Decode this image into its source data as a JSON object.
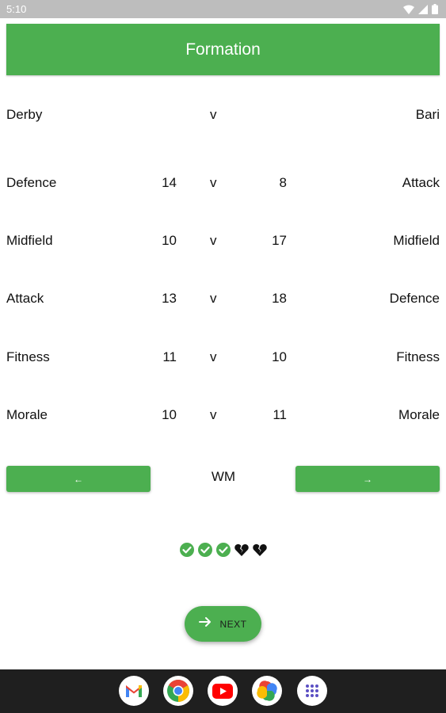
{
  "status_bar": {
    "time": "5:10"
  },
  "top_bar": {
    "title": "Formation"
  },
  "teams": {
    "home": "Derby",
    "vs": "v",
    "away": "Bari"
  },
  "stats": [
    {
      "left_label": "Defence",
      "left_value": "14",
      "vs": "v",
      "right_value": "8",
      "right_label": "Attack"
    },
    {
      "left_label": "Midfield",
      "left_value": "10",
      "vs": "v",
      "right_value": "17",
      "right_label": "Midfield"
    },
    {
      "left_label": "Attack",
      "left_value": "13",
      "vs": "v",
      "right_value": "18",
      "right_label": "Defence"
    },
    {
      "left_label": "Fitness",
      "left_value": "11",
      "vs": "v",
      "right_value": "10",
      "right_label": "Fitness"
    },
    {
      "left_label": "Morale",
      "left_value": "10",
      "vs": "v",
      "right_value": "11",
      "right_label": "Morale"
    }
  ],
  "formation": {
    "prev_label": "←",
    "name": "WM",
    "next_label": "→"
  },
  "form_icons": [
    "check-circle-icon",
    "check-circle-icon",
    "check-circle-icon",
    "broken-heart-icon",
    "broken-heart-icon"
  ],
  "next_button": {
    "label": "NEXT",
    "icon": "arrow-right-icon"
  },
  "nav_apps": [
    "gmail-icon",
    "chrome-icon",
    "youtube-icon",
    "photos-icon",
    "app-drawer-icon"
  ],
  "colors": {
    "accent": "#4caf50",
    "status_bar": "#bdbdbd",
    "nav_bar": "#1f1f1f"
  }
}
